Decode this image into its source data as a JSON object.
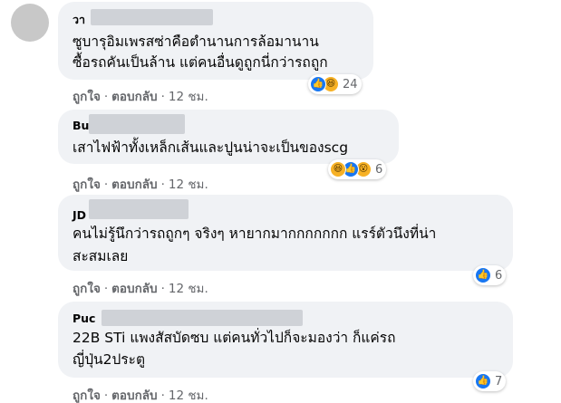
{
  "comments": [
    {
      "author": "วา",
      "lines": [
        "ซูบารุอิมเพรสซ่าคือตำนานการล้อมานาน",
        "ซื้อรถคันเป็นล้าน แต่คนอื่นดูถูกนี่กว่ารถถูก"
      ],
      "actions": {
        "like": "ถูกใจ",
        "reply": "ตอบกลับ",
        "time": "12 ชม."
      },
      "reactions": {
        "icons": [
          "like-icon",
          "haha-icon"
        ],
        "count": "24"
      }
    },
    {
      "author": "Bu",
      "lines": [
        "เสาไฟฟ้าทั้งเหล็กเส้นและปูนน่าจะเป็นของscg"
      ],
      "actions": {
        "like": "ถูกใจ",
        "reply": "ตอบกลับ",
        "time": "12 ชม."
      },
      "reactions": {
        "icons": [
          "haha-icon",
          "like-icon",
          "wow-icon"
        ],
        "count": "6"
      }
    },
    {
      "author": "JD",
      "lines": [
        "คนไม่รู้นึกว่ารถถูกๆ จริงๆ หายากมากกกกกกก แรร์ตัวนึงที่น่า",
        "สะสมเลย"
      ],
      "actions": {
        "like": "ถูกใจ",
        "reply": "ตอบกลับ",
        "time": "12 ชม."
      },
      "reactions": {
        "icons": [
          "like-icon"
        ],
        "count": "6"
      }
    },
    {
      "author": "Puc",
      "lines": [
        "22B STi แพงสัสบัดซบ แต่คนทั่วไปก็จะมองว่า ก็แค่รถ",
        "ญี่ปุ่น2ประตู"
      ],
      "actions": {
        "like": "ถูกใจ",
        "reply": "ตอบกลับ",
        "time": "12 ชม."
      },
      "reactions": {
        "icons": [
          "like-icon"
        ],
        "count": "7"
      }
    }
  ],
  "colors": {
    "bubble": "#f0f2f5",
    "like": "#1877f2",
    "haha": "#f7b125",
    "meta": "#65676b"
  }
}
